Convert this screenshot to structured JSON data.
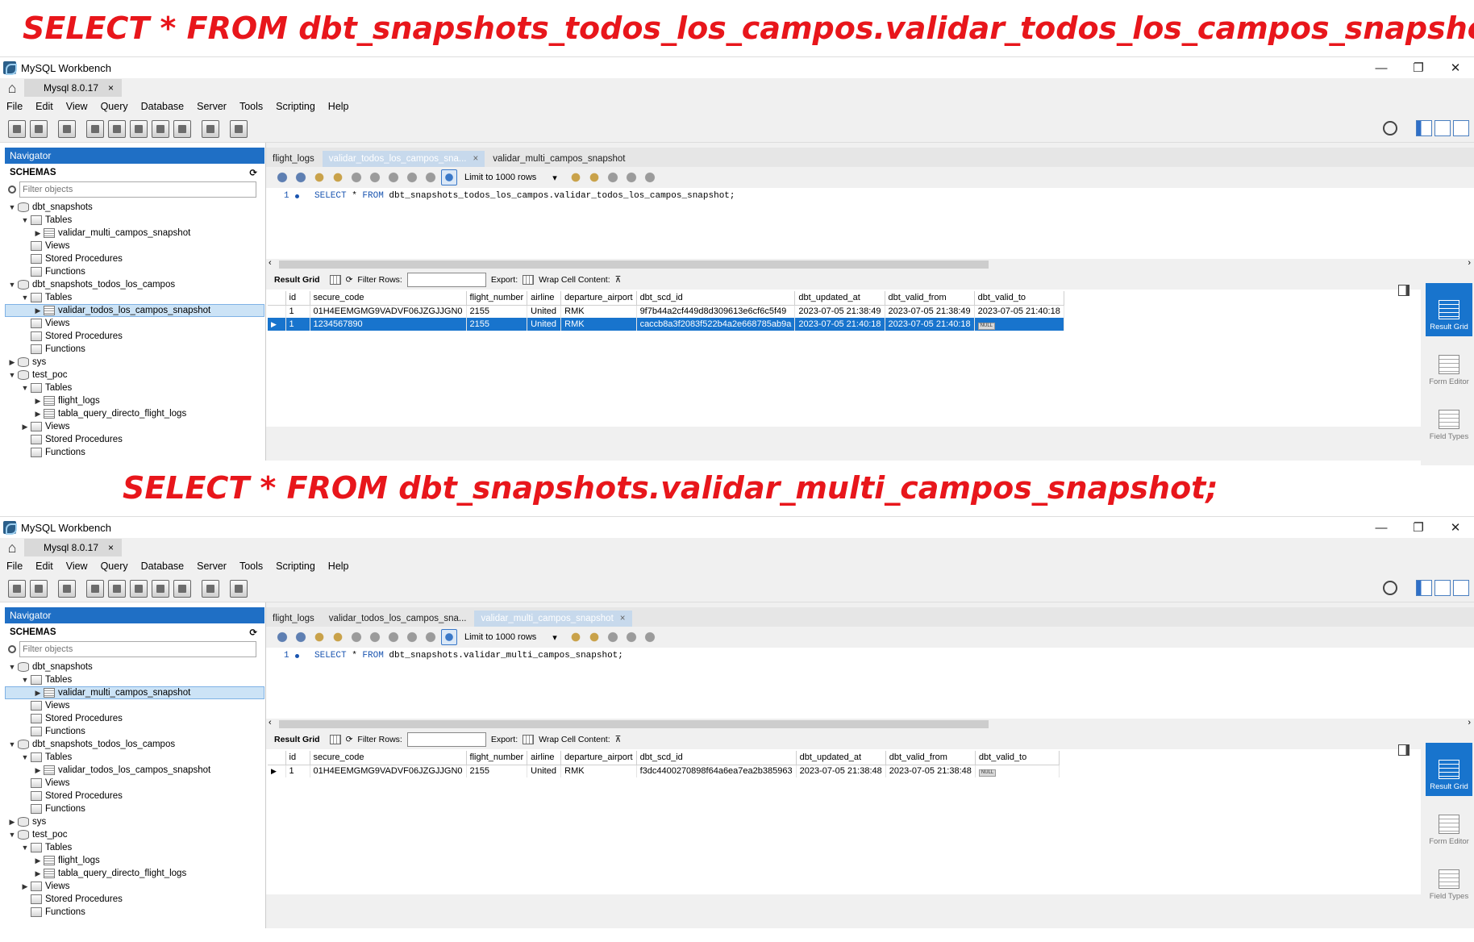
{
  "captions": [
    "SELECT * FROM dbt_snapshots_todos_los_campos.validar_todos_los_campos_snapshot;",
    "SELECT * FROM dbt_snapshots.validar_multi_campos_snapshot;"
  ],
  "app": {
    "title": "MySQL Workbench",
    "connection_tab": "Mysql 8.0.17",
    "close_glyph": "×",
    "window_controls": [
      "—",
      "❐",
      "✕"
    ],
    "menu": [
      "File",
      "Edit",
      "View",
      "Query",
      "Database",
      "Server",
      "Tools",
      "Scripting",
      "Help"
    ]
  },
  "navigator": {
    "header": "Navigator",
    "schemas_label": "SCHEMAS",
    "filter_placeholder": "Filter objects",
    "tree": [
      {
        "label": "dbt_snapshots",
        "level": 0,
        "type": "db",
        "open": true
      },
      {
        "label": "Tables",
        "level": 1,
        "type": "folder",
        "open": true
      },
      {
        "label": "validar_multi_campos_snapshot",
        "level": 2,
        "type": "table",
        "open": false
      },
      {
        "label": "Views",
        "level": 1,
        "type": "folder"
      },
      {
        "label": "Stored Procedures",
        "level": 1,
        "type": "folder"
      },
      {
        "label": "Functions",
        "level": 1,
        "type": "folder"
      },
      {
        "label": "dbt_snapshots_todos_los_campos",
        "level": 0,
        "type": "db",
        "open": true
      },
      {
        "label": "Tables",
        "level": 1,
        "type": "folder",
        "open": true
      },
      {
        "label": "validar_todos_los_campos_snapshot",
        "level": 2,
        "type": "table",
        "open": false
      },
      {
        "label": "Views",
        "level": 1,
        "type": "folder"
      },
      {
        "label": "Stored Procedures",
        "level": 1,
        "type": "folder"
      },
      {
        "label": "Functions",
        "level": 1,
        "type": "folder"
      },
      {
        "label": "sys",
        "level": 0,
        "type": "db",
        "open": false
      },
      {
        "label": "test_poc",
        "level": 0,
        "type": "db",
        "open": true
      },
      {
        "label": "Tables",
        "level": 1,
        "type": "folder",
        "open": true
      },
      {
        "label": "flight_logs",
        "level": 2,
        "type": "table",
        "open": false
      },
      {
        "label": "tabla_query_directo_flight_logs",
        "level": 2,
        "type": "table",
        "open": false
      },
      {
        "label": "Views",
        "level": 1,
        "type": "folder",
        "open": false
      },
      {
        "label": "Stored Procedures",
        "level": 1,
        "type": "folder"
      },
      {
        "label": "Functions",
        "level": 1,
        "type": "folder"
      }
    ]
  },
  "query_tabs": [
    "flight_logs",
    "validar_todos_los_campos_sna...",
    "validar_multi_campos_snapshot"
  ],
  "limit_label": "Limit to 1000 rows",
  "result_bar": {
    "result_grid": "Result Grid",
    "filter_rows": "Filter Rows:",
    "export": "Export:",
    "wrap": "Wrap Cell Content:"
  },
  "side_panel": [
    "Result Grid",
    "Form Editor",
    "Field Types"
  ],
  "columns": [
    "id",
    "secure_code",
    "flight_number",
    "airline",
    "departure_airport",
    "dbt_scd_id",
    "dbt_updated_at",
    "dbt_valid_from",
    "dbt_valid_to"
  ],
  "null_label": "NULL",
  "windows": [
    {
      "selected_tree_index": 8,
      "active_tab": 1,
      "line_no": "1",
      "sql_kw1": "SELECT",
      "sql_star": " * ",
      "sql_kw2": "FROM",
      "sql_rest": " dbt_snapshots_todos_los_campos.validar_todos_los_campos_snapshot;",
      "rows": [
        {
          "highlight": false,
          "cells": [
            "1",
            "01H4EEMGMG9VADVF06JZGJJGN0",
            "2155",
            "United",
            "RMK",
            "9f7b44a2cf449d8d309613e6cf6c5f49",
            "2023-07-05 21:38:49",
            "2023-07-05 21:38:49",
            "2023-07-05 21:40:18"
          ]
        },
        {
          "highlight": true,
          "cells": [
            "1",
            "1234567890",
            "2155",
            "United",
            "RMK",
            "caccb8a3f2083f522b4a2e668785ab9a",
            "2023-07-05 21:40:18",
            "2023-07-05 21:40:18",
            null
          ]
        }
      ]
    },
    {
      "selected_tree_index": 2,
      "active_tab": 2,
      "line_no": "1",
      "sql_kw1": "SELECT",
      "sql_star": " * ",
      "sql_kw2": "FROM",
      "sql_rest": " dbt_snapshots.validar_multi_campos_snapshot;",
      "rows": [
        {
          "highlight": false,
          "cells": [
            "1",
            "01H4EEMGMG9VADVF06JZGJJGN0",
            "2155",
            "United",
            "RMK",
            "f3dc4400270898f64a6ea7ea2b385963",
            "2023-07-05 21:38:48",
            "2023-07-05 21:38:48",
            null
          ]
        }
      ]
    }
  ]
}
